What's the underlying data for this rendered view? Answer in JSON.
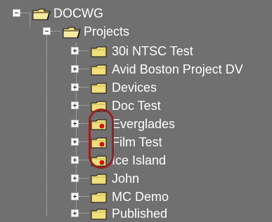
{
  "tree": {
    "root": {
      "label": "DOCWG",
      "expanded": true,
      "icon": "open-folder-icon"
    },
    "projects": {
      "label": "Projects",
      "expanded": true,
      "icon": "open-folder-icon"
    },
    "items": [
      {
        "label": "30i NTSC Test",
        "marker": false
      },
      {
        "label": "Avid Boston Project DV",
        "marker": false
      },
      {
        "label": "Devices",
        "marker": false
      },
      {
        "label": "Doc Test",
        "marker": false
      },
      {
        "label": "Everglades",
        "marker": true
      },
      {
        "label": "Film Test",
        "marker": true
      },
      {
        "label": "Ice Island",
        "marker": true
      },
      {
        "label": "John",
        "marker": false
      },
      {
        "label": "MC Demo",
        "marker": false
      },
      {
        "label": "Published",
        "marker": false
      }
    ]
  },
  "colors": {
    "panel_background": "#707070",
    "folder_yellow": "#f1df7a",
    "folder_shadow": "#c9b54f",
    "marker_red": "#ff0000",
    "highlight_red": "#9b1f1f",
    "text_white": "#ffffff"
  },
  "annotations": {
    "highlight": "red-rounded-oval-around-marked-folder-icons"
  }
}
